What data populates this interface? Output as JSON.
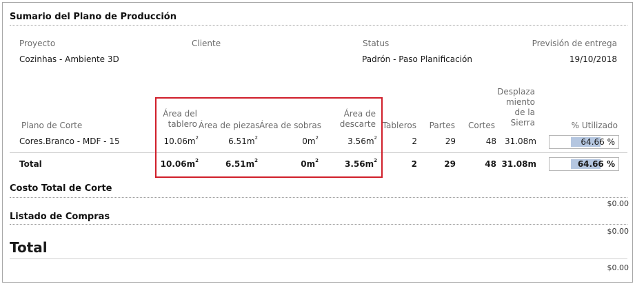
{
  "summary": {
    "title": "Sumario del Plano de Producción",
    "project_label": "Proyecto",
    "project_value": "Cozinhas - Ambiente 3D",
    "client_label": "Cliente",
    "client_value": "",
    "status_label": "Status",
    "status_value": "Padrón - Paso Planificación",
    "delivery_label": "Previsión de entrega",
    "delivery_value": "19/10/2018"
  },
  "table": {
    "headers": {
      "plan": "Plano de Corte",
      "board_area_l1": "Área del",
      "board_area_l2": "tablero",
      "parts_area": "Área de piezas",
      "leftover_area": "Área de sobras",
      "waste_area_l1": "Área de",
      "waste_area_l2": "descarte",
      "boards": "Tableros",
      "parts": "Partes",
      "cuts": "Cortes",
      "saw_l1": "Desplaza",
      "saw_l2": "miento",
      "saw_l3": "de la",
      "saw_l4": "Sierra",
      "used": "% Utilizado"
    },
    "row": {
      "plan": "Cores.Branco - MDF - 15",
      "board_area": "10.06m",
      "parts_area": "6.51m",
      "leftover_area": "0m",
      "waste_area": "3.56m",
      "sup": "2",
      "boards": "2",
      "parts": "29",
      "cuts": "48",
      "saw": "31.08m",
      "used": "64.66 %",
      "used_fraction": 0.6466
    },
    "total": {
      "label": "Total",
      "board_area": "10.06m",
      "parts_area": "6.51m",
      "leftover_area": "0m",
      "waste_area": "3.56m",
      "sup": "2",
      "boards": "2",
      "parts": "29",
      "cuts": "48",
      "saw": "31.08m",
      "used": "64.66 %",
      "used_fraction": 0.6466
    }
  },
  "cost": {
    "title": "Costo Total de Corte",
    "amount": "$0.00"
  },
  "purchases": {
    "title": "Listado de Compras",
    "amount": "$0.00"
  },
  "grand_total": {
    "title": "Total",
    "amount": "$0.00"
  },
  "colors": {
    "highlight": "#d01e2a",
    "bar": "#b4c6e0"
  }
}
